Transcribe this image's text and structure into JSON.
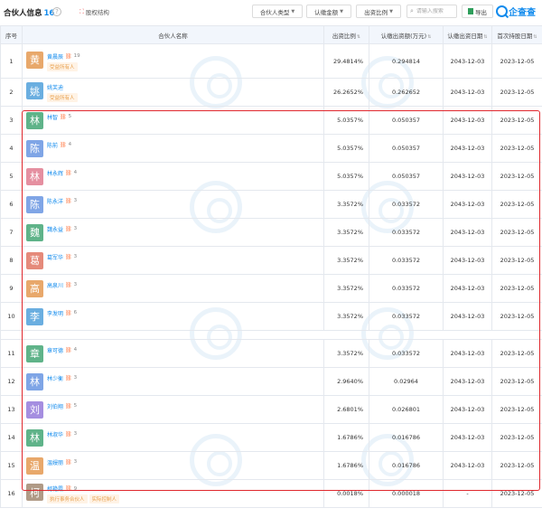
{
  "header": {
    "title": "合伙人信息",
    "count": "16",
    "equity_link": "股权结构",
    "filters": [
      {
        "label": "合伙人类型"
      },
      {
        "label": "认缴金额"
      },
      {
        "label": "出资比例"
      }
    ],
    "search_placeholder": "请输入搜索",
    "export_label": "导出",
    "brand": "企查查"
  },
  "table": {
    "columns": [
      "序号",
      "合伙人名称",
      "出资比例",
      "认缴出资额(万元)",
      "认缴出资日期",
      "首次持股日期"
    ],
    "rows": [
      {
        "idx": "1",
        "avatar": "黄",
        "color": "#e8a86b",
        "name": "黄晨辰",
        "rel": "19",
        "tags": [
          "受益所有人"
        ],
        "ratio": "29.4814%",
        "amount": "0.294814",
        "sub_date": "2043-12-03",
        "first_date": "2023-12-05"
      },
      {
        "idx": "2",
        "avatar": "姚",
        "color": "#6aaee0",
        "name": "姚芙迪",
        "rel": "",
        "tags": [
          "受益所有人"
        ],
        "ratio": "26.2652%",
        "amount": "0.262652",
        "sub_date": "2043-12-03",
        "first_date": "2023-12-05"
      },
      {
        "idx": "3",
        "avatar": "林",
        "color": "#5fb389",
        "name": "林智",
        "rel": "5",
        "tags": [],
        "ratio": "5.0357%",
        "amount": "0.050357",
        "sub_date": "2043-12-03",
        "first_date": "2023-12-05"
      },
      {
        "idx": "4",
        "avatar": "陈",
        "color": "#7fa5e6",
        "name": "陈前",
        "rel": "4",
        "tags": [],
        "ratio": "5.0357%",
        "amount": "0.050357",
        "sub_date": "2043-12-03",
        "first_date": "2023-12-05"
      },
      {
        "idx": "5",
        "avatar": "林",
        "color": "#e58fa0",
        "name": "林永辉",
        "rel": "4",
        "tags": [],
        "ratio": "5.0357%",
        "amount": "0.050357",
        "sub_date": "2043-12-03",
        "first_date": "2023-12-05"
      },
      {
        "idx": "6",
        "avatar": "陈",
        "color": "#7fa5e6",
        "name": "陈永洋",
        "rel": "3",
        "tags": [],
        "ratio": "3.3572%",
        "amount": "0.033572",
        "sub_date": "2043-12-03",
        "first_date": "2023-12-05"
      },
      {
        "idx": "7",
        "avatar": "魏",
        "color": "#5fb389",
        "name": "魏永益",
        "rel": "3",
        "tags": [],
        "ratio": "3.3572%",
        "amount": "0.033572",
        "sub_date": "2043-12-03",
        "first_date": "2023-12-05"
      },
      {
        "idx": "8",
        "avatar": "葛",
        "color": "#e58a7a",
        "name": "葛军华",
        "rel": "3",
        "tags": [],
        "ratio": "3.3572%",
        "amount": "0.033572",
        "sub_date": "2043-12-03",
        "first_date": "2023-12-05"
      },
      {
        "idx": "9",
        "avatar": "高",
        "color": "#e8a86b",
        "name": "高泉川",
        "rel": "3",
        "tags": [],
        "ratio": "3.3572%",
        "amount": "0.033572",
        "sub_date": "2043-12-03",
        "first_date": "2023-12-05"
      },
      {
        "idx": "10",
        "avatar": "李",
        "color": "#6aaee0",
        "name": "李发明",
        "rel": "6",
        "tags": [],
        "ratio": "3.3572%",
        "amount": "0.033572",
        "sub_date": "2043-12-03",
        "first_date": "2023-12-05"
      },
      {
        "idx": "11",
        "avatar": "章",
        "color": "#5fb389",
        "name": "章可德",
        "rel": "4",
        "tags": [],
        "ratio": "3.3572%",
        "amount": "0.033572",
        "sub_date": "2043-12-03",
        "first_date": "2023-12-05"
      },
      {
        "idx": "12",
        "avatar": "林",
        "color": "#7fa5e6",
        "name": "林少衡",
        "rel": "3",
        "tags": [],
        "ratio": "2.9640%",
        "amount": "0.02964",
        "sub_date": "2043-12-03",
        "first_date": "2023-12-05"
      },
      {
        "idx": "13",
        "avatar": "刘",
        "color": "#a58ee0",
        "name": "刘伯翔",
        "rel": "5",
        "tags": [],
        "ratio": "2.6801%",
        "amount": "0.026801",
        "sub_date": "2043-12-03",
        "first_date": "2023-12-05"
      },
      {
        "idx": "14",
        "avatar": "林",
        "color": "#5fb389",
        "name": "林淑华",
        "rel": "3",
        "tags": [],
        "ratio": "1.6786%",
        "amount": "0.016786",
        "sub_date": "2043-12-03",
        "first_date": "2023-12-05"
      },
      {
        "idx": "15",
        "avatar": "温",
        "color": "#e8a86b",
        "name": "温嫚丽",
        "rel": "3",
        "tags": [],
        "ratio": "1.6786%",
        "amount": "0.016786",
        "sub_date": "2043-12-03",
        "first_date": "2023-12-05"
      },
      {
        "idx": "16",
        "avatar": "柯",
        "color": "#b09a86",
        "name": "柯艳霞",
        "rel": "9",
        "tags": [
          "执行事务合伙人",
          "实际控制人"
        ],
        "ratio": "0.0018%",
        "amount": "0.000018",
        "sub_date": "-",
        "first_date": "2023-12-05"
      }
    ]
  }
}
